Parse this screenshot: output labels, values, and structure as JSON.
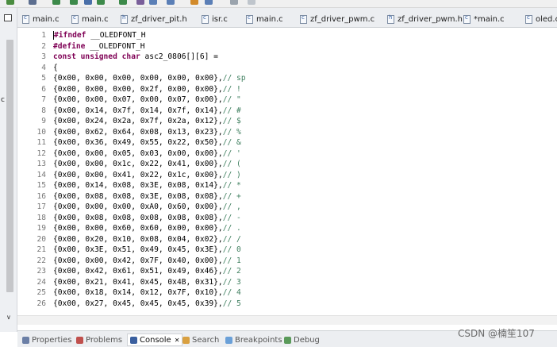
{
  "tabs": [
    {
      "label": "main.c",
      "icon": "c-file-icon"
    },
    {
      "label": "main.c",
      "icon": "c-file-icon"
    },
    {
      "label": "zf_driver_pit.h",
      "icon": "h-file-icon"
    },
    {
      "label": "isr.c",
      "icon": "c-file-icon"
    },
    {
      "label": "main.c",
      "icon": "c-file-icon"
    },
    {
      "label": "zf_driver_pwm.c",
      "icon": "c-file-icon"
    },
    {
      "label": "zf_driver_pwm.h",
      "icon": "h-file-icon"
    },
    {
      "label": "*main.c",
      "icon": "c-file-icon"
    },
    {
      "label": "oled.c",
      "icon": "c-file-icon"
    }
  ],
  "left_strip": {
    "clipped_text": "c"
  },
  "editor": {
    "lines": [
      {
        "num": "1",
        "kw": "#ifndef",
        "rest": " __OLEDFONT_H",
        "cm": ""
      },
      {
        "num": "2",
        "kw": "#define",
        "rest": " __OLEDFONT_H",
        "cm": ""
      },
      {
        "num": "3",
        "kw": "const unsigned char",
        "rest": " asc2_0806[][6] =",
        "cm": ""
      },
      {
        "num": "4",
        "kw": "",
        "rest": "{",
        "cm": ""
      },
      {
        "num": "5",
        "kw": "",
        "rest": "{0x00, 0x00, 0x00, 0x00, 0x00, 0x00},",
        "cm": "// sp"
      },
      {
        "num": "6",
        "kw": "",
        "rest": "{0x00, 0x00, 0x00, 0x2f, 0x00, 0x00},",
        "cm": "// !"
      },
      {
        "num": "7",
        "kw": "",
        "rest": "{0x00, 0x00, 0x07, 0x00, 0x07, 0x00},",
        "cm": "// \""
      },
      {
        "num": "8",
        "kw": "",
        "rest": "{0x00, 0x14, 0x7f, 0x14, 0x7f, 0x14},",
        "cm": "// #"
      },
      {
        "num": "9",
        "kw": "",
        "rest": "{0x00, 0x24, 0x2a, 0x7f, 0x2a, 0x12},",
        "cm": "// $"
      },
      {
        "num": "10",
        "kw": "",
        "rest": "{0x00, 0x62, 0x64, 0x08, 0x13, 0x23},",
        "cm": "// %"
      },
      {
        "num": "11",
        "kw": "",
        "rest": "{0x00, 0x36, 0x49, 0x55, 0x22, 0x50},",
        "cm": "// &"
      },
      {
        "num": "12",
        "kw": "",
        "rest": "{0x00, 0x00, 0x05, 0x03, 0x00, 0x00},",
        "cm": "// '"
      },
      {
        "num": "13",
        "kw": "",
        "rest": "{0x00, 0x00, 0x1c, 0x22, 0x41, 0x00},",
        "cm": "// ("
      },
      {
        "num": "14",
        "kw": "",
        "rest": "{0x00, 0x00, 0x41, 0x22, 0x1c, 0x00},",
        "cm": "// )"
      },
      {
        "num": "15",
        "kw": "",
        "rest": "{0x00, 0x14, 0x08, 0x3E, 0x08, 0x14},",
        "cm": "// *"
      },
      {
        "num": "16",
        "kw": "",
        "rest": "{0x00, 0x08, 0x08, 0x3E, 0x08, 0x08},",
        "cm": "// +"
      },
      {
        "num": "17",
        "kw": "",
        "rest": "{0x00, 0x00, 0x00, 0xA0, 0x60, 0x00},",
        "cm": "// ,"
      },
      {
        "num": "18",
        "kw": "",
        "rest": "{0x00, 0x08, 0x08, 0x08, 0x08, 0x08},",
        "cm": "// -"
      },
      {
        "num": "19",
        "kw": "",
        "rest": "{0x00, 0x00, 0x60, 0x60, 0x00, 0x00},",
        "cm": "// ."
      },
      {
        "num": "20",
        "kw": "",
        "rest": "{0x00, 0x20, 0x10, 0x08, 0x04, 0x02},",
        "cm": "// /"
      },
      {
        "num": "21",
        "kw": "",
        "rest": "{0x00, 0x3E, 0x51, 0x49, 0x45, 0x3E},",
        "cm": "// 0"
      },
      {
        "num": "22",
        "kw": "",
        "rest": "{0x00, 0x00, 0x42, 0x7F, 0x40, 0x00},",
        "cm": "// 1"
      },
      {
        "num": "23",
        "kw": "",
        "rest": "{0x00, 0x42, 0x61, 0x51, 0x49, 0x46},",
        "cm": "// 2"
      },
      {
        "num": "24",
        "kw": "",
        "rest": "{0x00, 0x21, 0x41, 0x45, 0x4B, 0x31},",
        "cm": "// 3"
      },
      {
        "num": "25",
        "kw": "",
        "rest": "{0x00, 0x18, 0x14, 0x12, 0x7F, 0x10},",
        "cm": "// 4"
      },
      {
        "num": "26",
        "kw": "",
        "rest": "{0x00, 0x27, 0x45, 0x45, 0x45, 0x39},",
        "cm": "// 5"
      }
    ]
  },
  "views": [
    {
      "label": "Properties",
      "icon": "properties-icon",
      "color": "#6b7fa6"
    },
    {
      "label": "Problems",
      "icon": "problems-icon",
      "color": "#c0504d"
    },
    {
      "label": "Console",
      "icon": "console-icon",
      "color": "#3a5f9f",
      "active": true
    },
    {
      "label": "Search",
      "icon": "search-icon",
      "color": "#d9a040"
    },
    {
      "label": "Breakpoints",
      "icon": "breakpoints-icon",
      "color": "#6aa0d8"
    },
    {
      "label": "Debug",
      "icon": "debug-icon",
      "color": "#5a9a5a"
    }
  ],
  "console_close": "✕",
  "watermark": "CSDN @楠笙107",
  "colors": {
    "keyword": "#7f0055",
    "comment": "#3f7f5f",
    "line_number": "#787878"
  }
}
